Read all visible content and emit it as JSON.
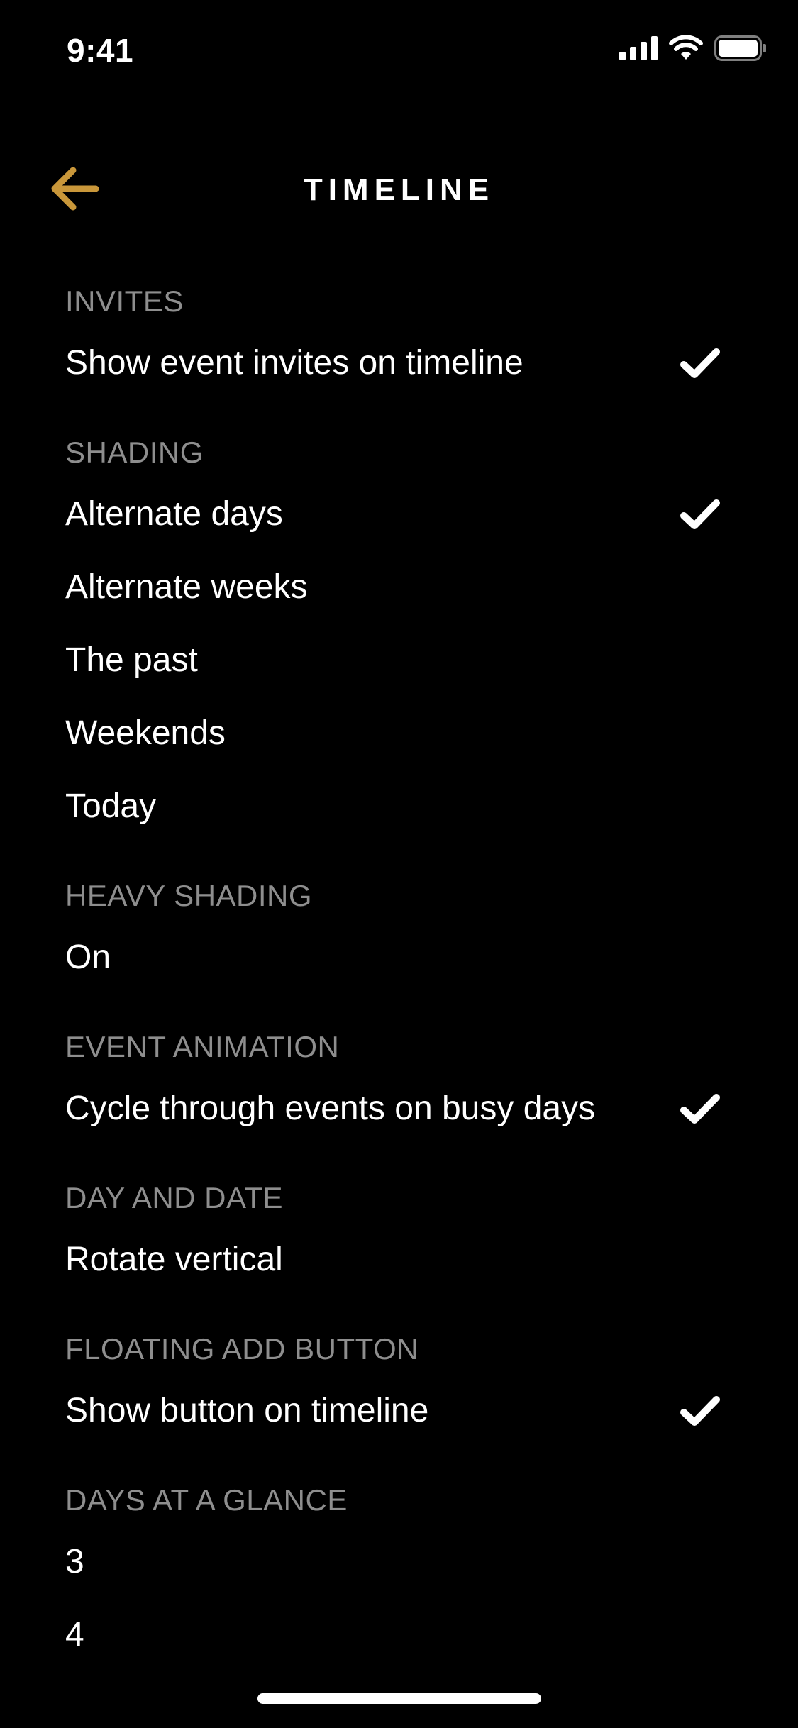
{
  "status": {
    "time": "9:41",
    "icons": [
      "cellular-signal-icon",
      "wifi-icon",
      "battery-icon"
    ]
  },
  "nav": {
    "title": "TIMELINE",
    "back_icon": "arrow-left-icon",
    "accent": "#c9973a"
  },
  "sections": [
    {
      "header": "INVITES",
      "items": [
        {
          "label": "Show event invites on timeline",
          "checked": true
        }
      ]
    },
    {
      "header": "SHADING",
      "items": [
        {
          "label": "Alternate days",
          "checked": true
        },
        {
          "label": "Alternate weeks",
          "checked": false
        },
        {
          "label": "The past",
          "checked": false
        },
        {
          "label": "Weekends",
          "checked": false
        },
        {
          "label": "Today",
          "checked": false
        }
      ]
    },
    {
      "header": "HEAVY SHADING",
      "items": [
        {
          "label": "On",
          "checked": false
        }
      ]
    },
    {
      "header": "EVENT ANIMATION",
      "items": [
        {
          "label": "Cycle through events on busy days",
          "checked": true
        }
      ]
    },
    {
      "header": "DAY AND DATE",
      "items": [
        {
          "label": "Rotate vertical",
          "checked": false
        }
      ]
    },
    {
      "header": "FLOATING ADD BUTTON",
      "items": [
        {
          "label": "Show button on timeline",
          "checked": true
        }
      ]
    },
    {
      "header": "DAYS AT A GLANCE",
      "items": [
        {
          "label": "3",
          "checked": false
        },
        {
          "label": "4",
          "checked": false
        }
      ]
    }
  ]
}
